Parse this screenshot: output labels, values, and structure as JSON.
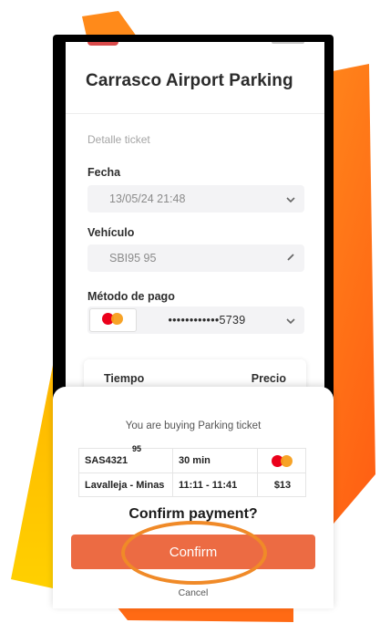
{
  "colors": {
    "accent": "#ec6b43",
    "highlight": "#f08a28",
    "background_shape": "#ff7f1e"
  },
  "header": {
    "title": "Carrasco Airport Parking"
  },
  "ticket": {
    "section_label": "Detalle ticket",
    "date": {
      "label": "Fecha",
      "value": "13/05/24 21:48",
      "icon": "chevron-down-icon"
    },
    "vehicle": {
      "label": "Vehículo",
      "value": "SBI95 95",
      "icon": "pencil-icon"
    },
    "payment": {
      "label": "Método de pago",
      "card_brand": "mastercard",
      "card_number": "••••••••••••5739",
      "icon": "chevron-down-icon"
    },
    "summary": {
      "time_label": "Tiempo",
      "price_label": "Precio"
    }
  },
  "sheet": {
    "subtitle": "You are buying Parking ticket",
    "overlay_number": "95",
    "rows": [
      {
        "plate": "SAS4321",
        "duration": "30 min",
        "payment_icon": "mastercard"
      },
      {
        "location": "Lavalleja - Minas",
        "time_range": "11:11 - 11:41",
        "price": "$13"
      }
    ],
    "question": "Confirm payment?",
    "confirm_label": "Confirm",
    "cancel_label": "Cancel"
  }
}
